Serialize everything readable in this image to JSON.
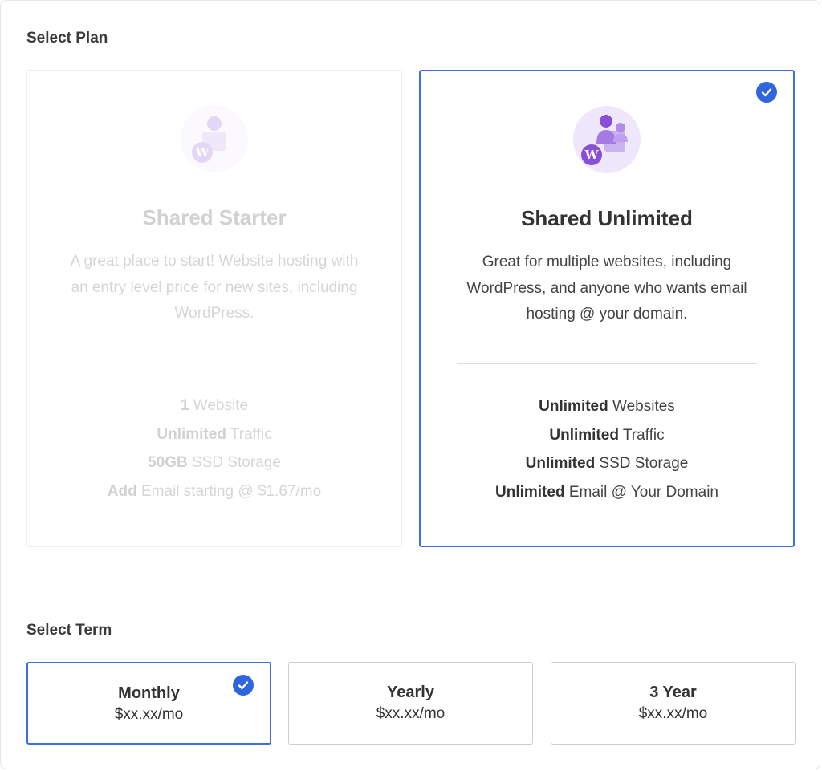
{
  "select_plan": {
    "title": "Select Plan"
  },
  "plans": [
    {
      "name": "Shared Starter",
      "selected": false,
      "description": "A great place to start! Website hosting with an entry level price for new sites, including WordPress.",
      "features": [
        {
          "bold": "1",
          "text": " Website"
        },
        {
          "bold": "Unlimited",
          "text": " Traffic"
        },
        {
          "bold": "50GB",
          "text": " SSD Storage"
        },
        {
          "bold": "Add",
          "text": " Email starting @ $1.67/mo"
        }
      ],
      "icon": "wordpress-user-icon"
    },
    {
      "name": "Shared Unlimited",
      "selected": true,
      "description": "Great for multiple websites, including WordPress, and anyone who wants email hosting @ your domain.",
      "features": [
        {
          "bold": "Unlimited",
          "text": " Websites"
        },
        {
          "bold": "Unlimited",
          "text": " Traffic"
        },
        {
          "bold": "Unlimited",
          "text": " SSD Storage"
        },
        {
          "bold": "Unlimited",
          "text": " Email @ Your Domain"
        }
      ],
      "icon": "wordpress-team-icon"
    }
  ],
  "select_term": {
    "title": "Select Term"
  },
  "terms": [
    {
      "name": "Monthly",
      "price": "$xx.xx/mo",
      "selected": true
    },
    {
      "name": "Yearly",
      "price": "$xx.xx/mo",
      "selected": false
    },
    {
      "name": "3 Year",
      "price": "$xx.xx/mo",
      "selected": false
    }
  ],
  "colors": {
    "accent": "#2f66df",
    "border_selected": "#3d6fe0",
    "border_default": "#c8ced6",
    "icon_purple": "#8a4fd8"
  }
}
